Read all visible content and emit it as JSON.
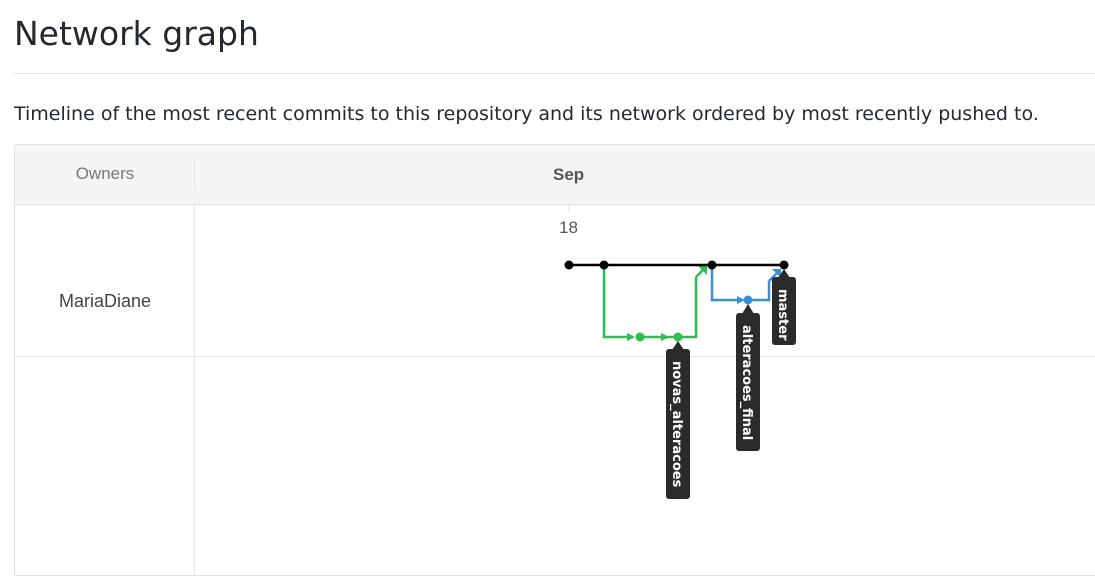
{
  "page": {
    "title": "Network graph",
    "subtitle": "Timeline of the most recent commits to this repository and its network ordered by most recently pushed to."
  },
  "graph": {
    "owners_header": "Owners",
    "month": "Sep",
    "day": "18",
    "owners": [
      "MariaDiane"
    ],
    "branches": [
      {
        "name": "novas_alteracoes",
        "color": "#2cbe4e"
      },
      {
        "name": "alteracoes_final",
        "color": "#3a8fd6"
      },
      {
        "name": "master",
        "color": "#000000"
      }
    ],
    "branch_tags": {
      "novas": "novas_alteracoes",
      "final": "alteracoes_final",
      "master": "master"
    },
    "colors": {
      "master": "#000000",
      "green": "#2cbe4e",
      "blue": "#3a8fd6",
      "tag_bg": "#2b2b2b"
    }
  }
}
